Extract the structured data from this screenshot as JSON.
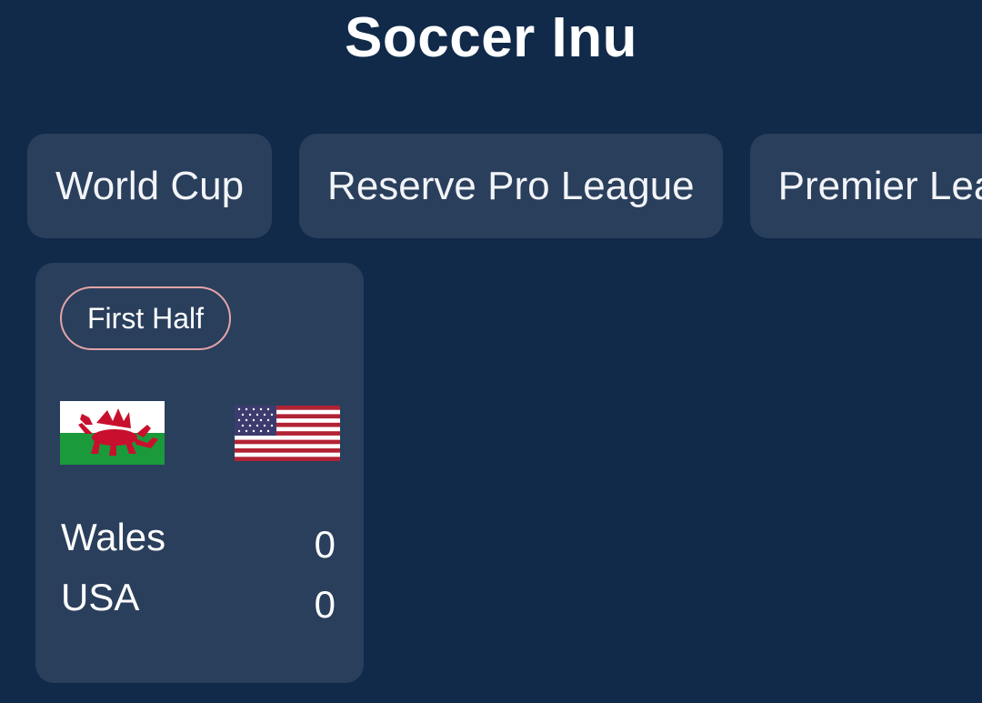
{
  "app": {
    "title": "Soccer Inu"
  },
  "tabs": [
    {
      "label": "World Cup"
    },
    {
      "label": "Reserve Pro League"
    },
    {
      "label": "Premier League"
    }
  ],
  "matches": [
    {
      "status": "First Half",
      "home": {
        "name": "Wales",
        "score": "0",
        "flag_icon": "wales-flag-icon"
      },
      "away": {
        "name": "USA",
        "score": "0",
        "flag_icon": "usa-flag-icon"
      }
    }
  ],
  "colors": {
    "background": "#112a4a",
    "surface": "#2a3f5c",
    "status_border": "#e3a4a8",
    "text": "#ffffff"
  }
}
